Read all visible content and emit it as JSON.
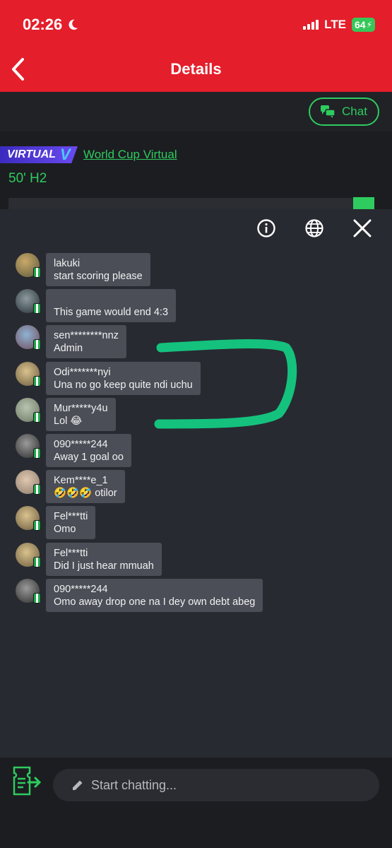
{
  "status": {
    "time": "02:26",
    "network": "LTE",
    "battery": "64"
  },
  "header": {
    "title": "Details"
  },
  "chat_button": {
    "label": "Chat"
  },
  "match": {
    "badge": "VIRTUAL",
    "competition": "World Cup Virtual",
    "minute": "50' H2"
  },
  "messages": [
    {
      "user": "lakuki",
      "text": "start scoring please"
    },
    {
      "user": "",
      "text": "This game would end 4:3"
    },
    {
      "user": "sen********nnz",
      "text": "Admin"
    },
    {
      "user": "Odi*******nyi",
      "text": "Una no go keep quite ndi uchu"
    },
    {
      "user": "Mur*****y4u",
      "text": "Lol 😂"
    },
    {
      "user": "090*****244",
      "text": "Away 1 goal oo"
    },
    {
      "user": "Kem****e_1",
      "text": "🤣🤣🤣 otilor"
    },
    {
      "user": "Fel***tti",
      "text": "Omo"
    },
    {
      "user": "Fel***tti",
      "text": "Did I just hear mmuah"
    },
    {
      "user": "090*****244",
      "text": "Omo away drop one na I dey own debt abeg"
    }
  ],
  "composer": {
    "placeholder": "Start chatting..."
  },
  "colors": {
    "header": "#e41e2b",
    "accent": "#2ecc5f",
    "bubble": "#4b4e57",
    "panel": "#282a31"
  },
  "icons": [
    "moon-icon",
    "back-chevron-icon",
    "chat-icon",
    "info-icon",
    "globe-icon",
    "close-icon",
    "bet-ticket-icon",
    "pencil-icon"
  ]
}
